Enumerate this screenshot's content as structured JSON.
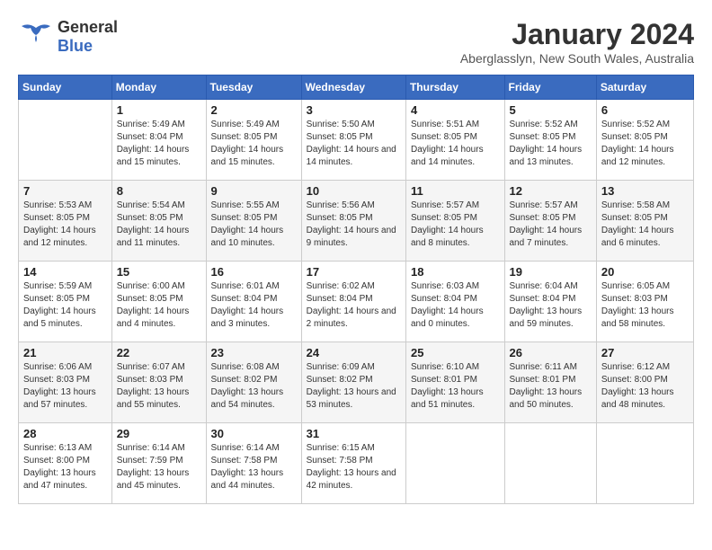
{
  "logo": {
    "text_general": "General",
    "text_blue": "Blue"
  },
  "header": {
    "month": "January 2024",
    "location": "Aberglasslyn, New South Wales, Australia"
  },
  "weekdays": [
    "Sunday",
    "Monday",
    "Tuesday",
    "Wednesday",
    "Thursday",
    "Friday",
    "Saturday"
  ],
  "weeks": [
    [
      {
        "day": "",
        "sunrise": "",
        "sunset": "",
        "daylight": ""
      },
      {
        "day": "1",
        "sunrise": "Sunrise: 5:49 AM",
        "sunset": "Sunset: 8:04 PM",
        "daylight": "Daylight: 14 hours and 15 minutes."
      },
      {
        "day": "2",
        "sunrise": "Sunrise: 5:49 AM",
        "sunset": "Sunset: 8:05 PM",
        "daylight": "Daylight: 14 hours and 15 minutes."
      },
      {
        "day": "3",
        "sunrise": "Sunrise: 5:50 AM",
        "sunset": "Sunset: 8:05 PM",
        "daylight": "Daylight: 14 hours and 14 minutes."
      },
      {
        "day": "4",
        "sunrise": "Sunrise: 5:51 AM",
        "sunset": "Sunset: 8:05 PM",
        "daylight": "Daylight: 14 hours and 14 minutes."
      },
      {
        "day": "5",
        "sunrise": "Sunrise: 5:52 AM",
        "sunset": "Sunset: 8:05 PM",
        "daylight": "Daylight: 14 hours and 13 minutes."
      },
      {
        "day": "6",
        "sunrise": "Sunrise: 5:52 AM",
        "sunset": "Sunset: 8:05 PM",
        "daylight": "Daylight: 14 hours and 12 minutes."
      }
    ],
    [
      {
        "day": "7",
        "sunrise": "Sunrise: 5:53 AM",
        "sunset": "Sunset: 8:05 PM",
        "daylight": "Daylight: 14 hours and 12 minutes."
      },
      {
        "day": "8",
        "sunrise": "Sunrise: 5:54 AM",
        "sunset": "Sunset: 8:05 PM",
        "daylight": "Daylight: 14 hours and 11 minutes."
      },
      {
        "day": "9",
        "sunrise": "Sunrise: 5:55 AM",
        "sunset": "Sunset: 8:05 PM",
        "daylight": "Daylight: 14 hours and 10 minutes."
      },
      {
        "day": "10",
        "sunrise": "Sunrise: 5:56 AM",
        "sunset": "Sunset: 8:05 PM",
        "daylight": "Daylight: 14 hours and 9 minutes."
      },
      {
        "day": "11",
        "sunrise": "Sunrise: 5:57 AM",
        "sunset": "Sunset: 8:05 PM",
        "daylight": "Daylight: 14 hours and 8 minutes."
      },
      {
        "day": "12",
        "sunrise": "Sunrise: 5:57 AM",
        "sunset": "Sunset: 8:05 PM",
        "daylight": "Daylight: 14 hours and 7 minutes."
      },
      {
        "day": "13",
        "sunrise": "Sunrise: 5:58 AM",
        "sunset": "Sunset: 8:05 PM",
        "daylight": "Daylight: 14 hours and 6 minutes."
      }
    ],
    [
      {
        "day": "14",
        "sunrise": "Sunrise: 5:59 AM",
        "sunset": "Sunset: 8:05 PM",
        "daylight": "Daylight: 14 hours and 5 minutes."
      },
      {
        "day": "15",
        "sunrise": "Sunrise: 6:00 AM",
        "sunset": "Sunset: 8:05 PM",
        "daylight": "Daylight: 14 hours and 4 minutes."
      },
      {
        "day": "16",
        "sunrise": "Sunrise: 6:01 AM",
        "sunset": "Sunset: 8:04 PM",
        "daylight": "Daylight: 14 hours and 3 minutes."
      },
      {
        "day": "17",
        "sunrise": "Sunrise: 6:02 AM",
        "sunset": "Sunset: 8:04 PM",
        "daylight": "Daylight: 14 hours and 2 minutes."
      },
      {
        "day": "18",
        "sunrise": "Sunrise: 6:03 AM",
        "sunset": "Sunset: 8:04 PM",
        "daylight": "Daylight: 14 hours and 0 minutes."
      },
      {
        "day": "19",
        "sunrise": "Sunrise: 6:04 AM",
        "sunset": "Sunset: 8:04 PM",
        "daylight": "Daylight: 13 hours and 59 minutes."
      },
      {
        "day": "20",
        "sunrise": "Sunrise: 6:05 AM",
        "sunset": "Sunset: 8:03 PM",
        "daylight": "Daylight: 13 hours and 58 minutes."
      }
    ],
    [
      {
        "day": "21",
        "sunrise": "Sunrise: 6:06 AM",
        "sunset": "Sunset: 8:03 PM",
        "daylight": "Daylight: 13 hours and 57 minutes."
      },
      {
        "day": "22",
        "sunrise": "Sunrise: 6:07 AM",
        "sunset": "Sunset: 8:03 PM",
        "daylight": "Daylight: 13 hours and 55 minutes."
      },
      {
        "day": "23",
        "sunrise": "Sunrise: 6:08 AM",
        "sunset": "Sunset: 8:02 PM",
        "daylight": "Daylight: 13 hours and 54 minutes."
      },
      {
        "day": "24",
        "sunrise": "Sunrise: 6:09 AM",
        "sunset": "Sunset: 8:02 PM",
        "daylight": "Daylight: 13 hours and 53 minutes."
      },
      {
        "day": "25",
        "sunrise": "Sunrise: 6:10 AM",
        "sunset": "Sunset: 8:01 PM",
        "daylight": "Daylight: 13 hours and 51 minutes."
      },
      {
        "day": "26",
        "sunrise": "Sunrise: 6:11 AM",
        "sunset": "Sunset: 8:01 PM",
        "daylight": "Daylight: 13 hours and 50 minutes."
      },
      {
        "day": "27",
        "sunrise": "Sunrise: 6:12 AM",
        "sunset": "Sunset: 8:00 PM",
        "daylight": "Daylight: 13 hours and 48 minutes."
      }
    ],
    [
      {
        "day": "28",
        "sunrise": "Sunrise: 6:13 AM",
        "sunset": "Sunset: 8:00 PM",
        "daylight": "Daylight: 13 hours and 47 minutes."
      },
      {
        "day": "29",
        "sunrise": "Sunrise: 6:14 AM",
        "sunset": "Sunset: 7:59 PM",
        "daylight": "Daylight: 13 hours and 45 minutes."
      },
      {
        "day": "30",
        "sunrise": "Sunrise: 6:14 AM",
        "sunset": "Sunset: 7:58 PM",
        "daylight": "Daylight: 13 hours and 44 minutes."
      },
      {
        "day": "31",
        "sunrise": "Sunrise: 6:15 AM",
        "sunset": "Sunset: 7:58 PM",
        "daylight": "Daylight: 13 hours and 42 minutes."
      },
      {
        "day": "",
        "sunrise": "",
        "sunset": "",
        "daylight": ""
      },
      {
        "day": "",
        "sunrise": "",
        "sunset": "",
        "daylight": ""
      },
      {
        "day": "",
        "sunrise": "",
        "sunset": "",
        "daylight": ""
      }
    ]
  ]
}
